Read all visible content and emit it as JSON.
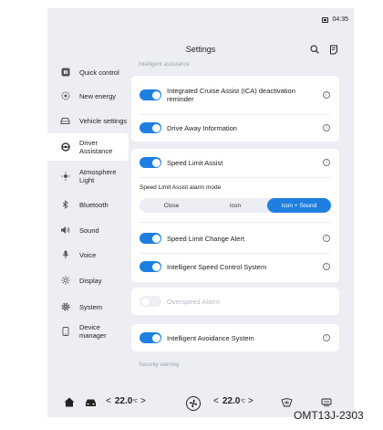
{
  "status": {
    "time": "04:35"
  },
  "header": {
    "title": "Settings"
  },
  "sidebar": {
    "items": [
      {
        "label": "Quick control",
        "icon": "quick-control-icon",
        "active": false
      },
      {
        "label": "New energy",
        "icon": "new-energy-icon",
        "active": false
      },
      {
        "label": "Vehicle settings",
        "icon": "vehicle-icon",
        "active": false
      },
      {
        "label": "Driver Assistance",
        "icon": "steering-wheel-icon",
        "active": true
      },
      {
        "label": "Atmosphere Light",
        "icon": "atmosphere-light-icon",
        "active": false
      },
      {
        "label": "Bluetooth",
        "icon": "bluetooth-icon",
        "active": false
      },
      {
        "label": "Sound",
        "icon": "sound-icon",
        "active": false
      },
      {
        "label": "Voice",
        "icon": "microphone-icon",
        "active": false
      },
      {
        "label": "Display",
        "icon": "brightness-icon",
        "active": false
      },
      {
        "label": "System",
        "icon": "gear-icon",
        "active": false
      },
      {
        "label": "Device manager",
        "icon": "device-icon",
        "active": false
      }
    ]
  },
  "main": {
    "section_intelligent": "Intelligent assistance",
    "ica_reminder": {
      "label": "Integrated Cruise Assist (ICA) deactivation reminder",
      "on": true
    },
    "drive_away": {
      "label": "Drive Away Information",
      "on": true
    },
    "speed_limit_assist": {
      "label": "Speed Limit Assist",
      "on": true
    },
    "alarm_mode": {
      "label": "Speed Limit Assist alarm mode",
      "options": [
        "Close",
        "Icon",
        "Icon + Sound"
      ],
      "selected": "Icon + Sound"
    },
    "speed_limit_change": {
      "label": "Speed Limit Change Alert",
      "on": true
    },
    "speed_control": {
      "label": "Intelligent Speed Control System",
      "on": true
    },
    "overspeed": {
      "label": "Overspeed Alarm",
      "on": false,
      "disabled": true
    },
    "avoidance": {
      "label": "Intelligent Avoidance System",
      "on": true
    },
    "section_security": "Security warning"
  },
  "bottom": {
    "left_temp": "22.0",
    "right_temp": "22.0",
    "temp_unit": "℃",
    "left_arrow": "<",
    "right_arrow": ">"
  },
  "watermark": "OMT13J-2303",
  "colors": {
    "accent": "#1f7fe0",
    "background": "#eceef4"
  }
}
